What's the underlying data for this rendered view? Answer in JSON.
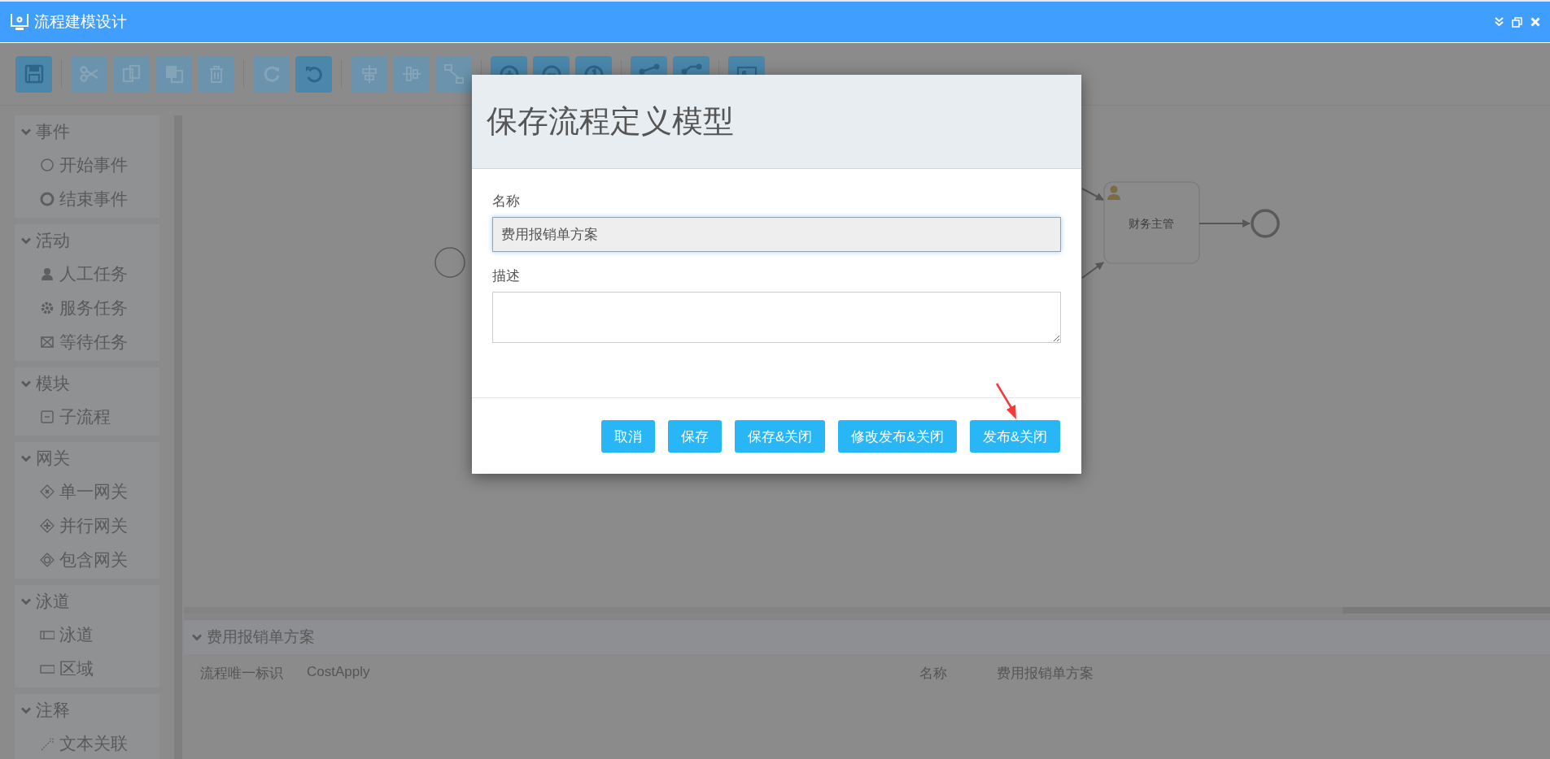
{
  "window": {
    "title": "流程建模设计"
  },
  "toolbar": {
    "groups": [
      {
        "buttons": [
          {
            "disabled": false
          }
        ]
      },
      {
        "buttons": [
          {
            "disabled": true
          },
          {
            "disabled": true
          },
          {
            "disabled": true
          },
          {
            "disabled": true
          }
        ]
      },
      {
        "buttons": [
          {
            "disabled": true
          },
          {
            "disabled": false
          }
        ]
      },
      {
        "buttons": [
          {
            "disabled": true
          },
          {
            "disabled": true
          },
          {
            "disabled": true
          }
        ]
      },
      {
        "buttons": [
          {
            "disabled": false
          },
          {
            "disabled": false
          },
          {
            "disabled": false
          }
        ]
      },
      {
        "buttons": [
          {
            "disabled": false
          },
          {
            "disabled": false
          }
        ]
      },
      {
        "buttons": [
          {
            "disabled": false
          }
        ]
      }
    ]
  },
  "sidebar": {
    "groups": [
      {
        "title": "事件",
        "expanded": true,
        "items": [
          {
            "label": "开始事件",
            "kind": "start"
          },
          {
            "label": "结束事件",
            "kind": "end"
          }
        ]
      },
      {
        "title": "活动",
        "expanded": true,
        "items": [
          {
            "label": "人工任务",
            "kind": "user"
          },
          {
            "label": "服务任务",
            "kind": "service"
          },
          {
            "label": "等待任务",
            "kind": "receive"
          }
        ]
      },
      {
        "title": "模块",
        "expanded": true,
        "items": [
          {
            "label": "子流程",
            "kind": "subprocess"
          }
        ]
      },
      {
        "title": "网关",
        "expanded": true,
        "items": [
          {
            "label": "单一网关",
            "kind": "exclusive"
          },
          {
            "label": "并行网关",
            "kind": "parallel"
          },
          {
            "label": "包含网关",
            "kind": "inclusive"
          }
        ]
      },
      {
        "title": "泳道",
        "expanded": true,
        "items": [
          {
            "label": "泳道",
            "kind": "pool"
          },
          {
            "label": "区域",
            "kind": "lane"
          }
        ]
      },
      {
        "title": "注释",
        "expanded": true,
        "items": [
          {
            "label": "文本关联",
            "kind": "association"
          }
        ]
      }
    ]
  },
  "canvas": {
    "task": {
      "label": "财务主管"
    }
  },
  "properties": {
    "title": "费用报销单方案",
    "expanded": true,
    "rows": [
      {
        "label": "流程唯一标识",
        "value": "CostApply"
      },
      {
        "label": "名称",
        "value": "费用报销单方案"
      }
    ]
  },
  "dialog": {
    "title": "保存流程定义模型",
    "fields": [
      {
        "label": "名称",
        "kind": "text",
        "value": "费用报销单方案"
      },
      {
        "label": "描述",
        "kind": "textarea"
      }
    ],
    "buttons": [
      "取消",
      "保存",
      "保存&关闭",
      "修改发布&关闭",
      "发布&关闭"
    ]
  }
}
